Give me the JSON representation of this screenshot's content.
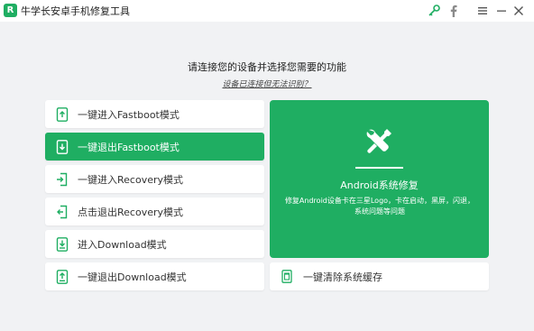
{
  "app": {
    "title": "牛学长安卓手机修复工具",
    "logo_letter": "R",
    "brand_color": "#1fae62"
  },
  "titlebar_icons": [
    "key-icon",
    "facebook-icon",
    "menu-icon",
    "minimize-icon",
    "close-icon"
  ],
  "main": {
    "heading": "请连接您的设备并选择您需要的功能",
    "help_link": "设备已连接但无法识别？"
  },
  "modes": [
    {
      "label": "一键进入Fastboot模式",
      "icon": "phone-arrow-up-icon",
      "active": false
    },
    {
      "label": "一键退出Fastboot模式",
      "icon": "phone-arrow-down-icon",
      "active": true
    },
    {
      "label": "一键进入Recovery模式",
      "icon": "phone-enter-icon",
      "active": false
    },
    {
      "label": "点击退出Recovery模式",
      "icon": "phone-exit-icon",
      "active": false
    },
    {
      "label": "进入Download模式",
      "icon": "phone-download-icon",
      "active": false
    },
    {
      "label": "一键退出Download模式",
      "icon": "phone-upload-icon",
      "active": false
    }
  ],
  "repair_card": {
    "title": "Android系统修复",
    "description": "修复Android设备卡在三星Logo，卡在启动，黑屏，闪退，系统问题等问题",
    "icon": "tools-icon"
  },
  "clear_cache": {
    "label": "一键清除系统缓存",
    "icon": "trash-phone-icon"
  }
}
